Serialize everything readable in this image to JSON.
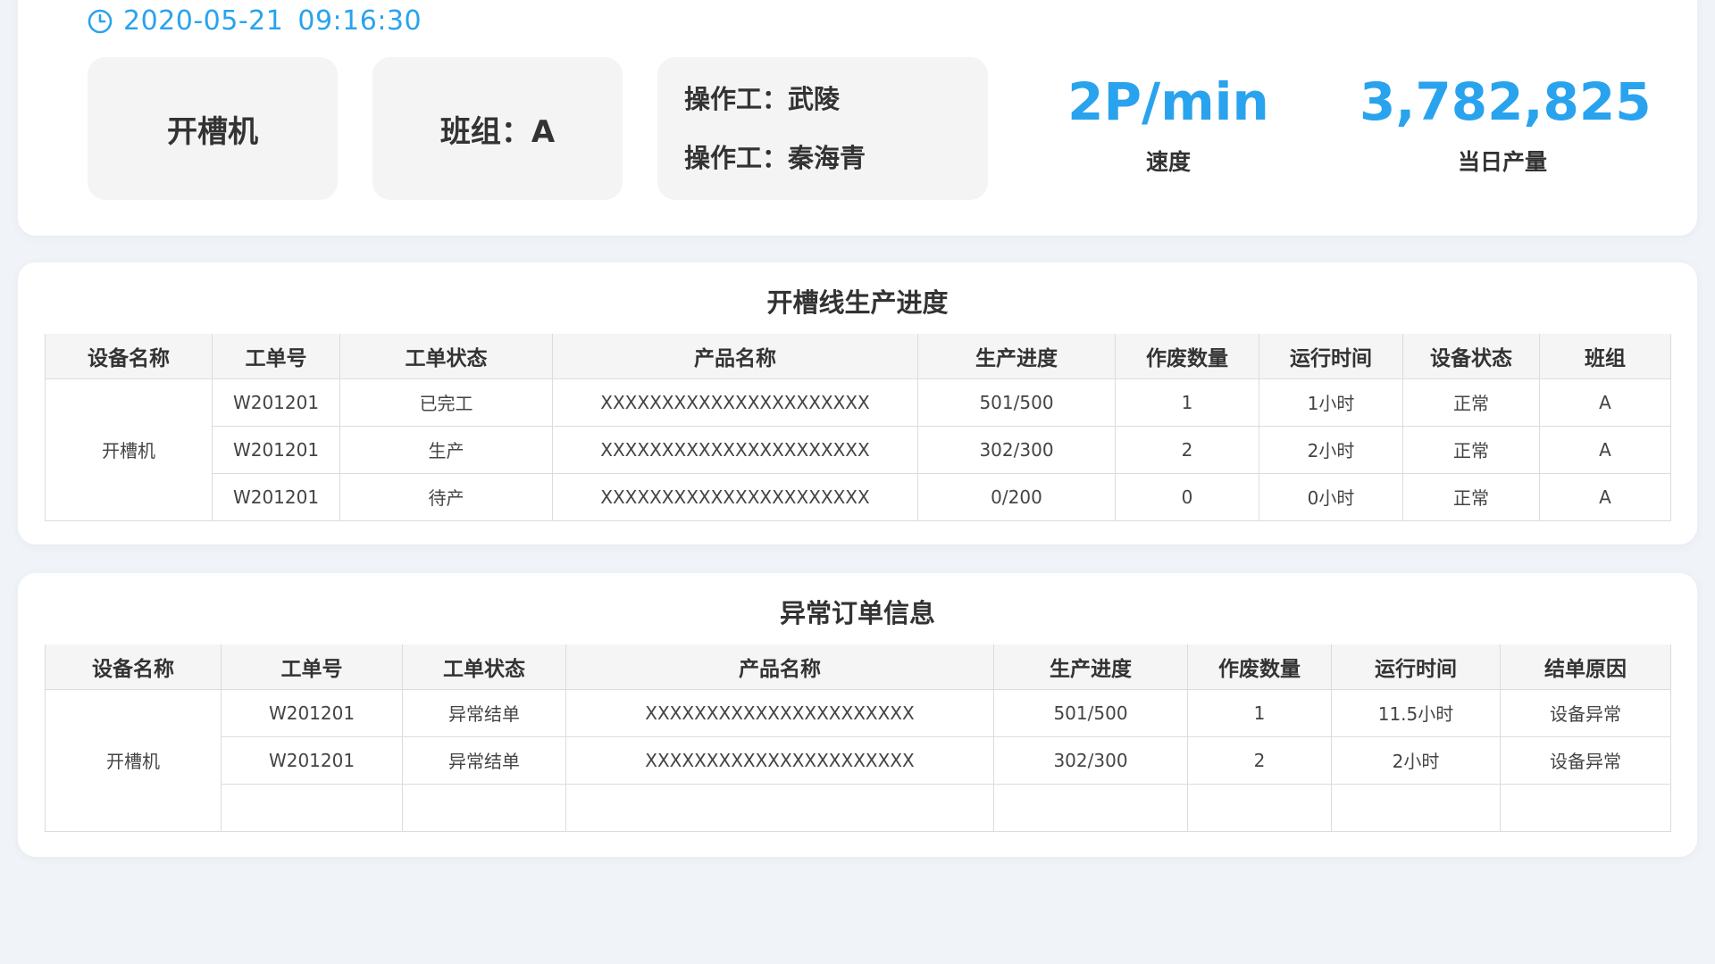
{
  "header": {
    "date": "2020-05-21",
    "time": "09:16:30",
    "machine": "开槽机",
    "team_label": "班组：A",
    "operators": [
      {
        "label": "操作工：",
        "name": "武陵"
      },
      {
        "label": "操作工：",
        "name": "秦海青"
      }
    ],
    "speed": {
      "value": "2P/min",
      "label": "速度"
    },
    "daily_output": {
      "value": "3,782,825",
      "label": "当日产量"
    }
  },
  "progress_table": {
    "title": "开槽线生产进度",
    "columns": [
      "设备名称",
      "工单号",
      "工单状态",
      "产品名称",
      "生产进度",
      "作废数量",
      "运行时间",
      "设备状态",
      "班组"
    ],
    "device": "开槽机",
    "rows": [
      {
        "order": "W201201",
        "order_status": "已完工",
        "product": "XXXXXXXXXXXXXXXXXXXXXX",
        "progress": "501/500",
        "scrap": "1",
        "runtime": "1小时",
        "device_status": "正常",
        "team": "A"
      },
      {
        "order": "W201201",
        "order_status": "生产",
        "product": "XXXXXXXXXXXXXXXXXXXXXX",
        "progress": "302/300",
        "scrap": "2",
        "runtime": "2小时",
        "device_status": "正常",
        "team": "A"
      },
      {
        "order": "W201201",
        "order_status": "待产",
        "product": "XXXXXXXXXXXXXXXXXXXXXX",
        "progress": "0/200",
        "scrap": "0",
        "runtime": "0小时",
        "device_status": "正常",
        "team": "A"
      }
    ]
  },
  "abnormal_table": {
    "title": "异常订单信息",
    "columns": [
      "设备名称",
      "工单号",
      "工单状态",
      "产品名称",
      "生产进度",
      "作废数量",
      "运行时间",
      "结单原因"
    ],
    "device": "开槽机",
    "rows": [
      {
        "order": "W201201",
        "order_status": "异常结单",
        "product": "XXXXXXXXXXXXXXXXXXXXXX",
        "progress": "501/500",
        "scrap": "1",
        "runtime": "11.5小时",
        "reason": "设备异常"
      },
      {
        "order": "W201201",
        "order_status": "异常结单",
        "product": "XXXXXXXXXXXXXXXXXXXXXX",
        "progress": "302/300",
        "scrap": "2",
        "runtime": "2小时",
        "reason": "设备异常"
      },
      {
        "order": "",
        "order_status": "",
        "product": "",
        "progress": "",
        "scrap": "",
        "runtime": "",
        "reason": ""
      }
    ]
  },
  "colors": {
    "accent": "#29a3ee",
    "background": "#f0f4f8",
    "card": "#ffffff",
    "box": "#f4f4f4"
  },
  "icons": {
    "datetime": "clock-icon"
  }
}
